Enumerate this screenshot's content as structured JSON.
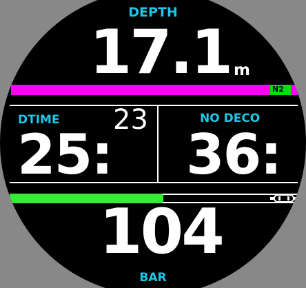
{
  "depth": {
    "label": "DEPTH",
    "value": "17.1",
    "unit": "m"
  },
  "n2": {
    "label": "N2",
    "bar_color": "#ff00ff",
    "tag_color": "#00e000"
  },
  "dive_time": {
    "label": "DTIME",
    "minutes": "25:",
    "seconds": "23"
  },
  "no_deco": {
    "label": "NO DECO",
    "value": "36:"
  },
  "gas": {
    "fill_fraction": 0.53,
    "bar_color": "#33ee33"
  },
  "pressure": {
    "value": "104",
    "unit": "BAR"
  },
  "colors": {
    "accent": "#19c8e8",
    "text": "#ffffff",
    "background": "#000000",
    "bezel": "#888888"
  }
}
